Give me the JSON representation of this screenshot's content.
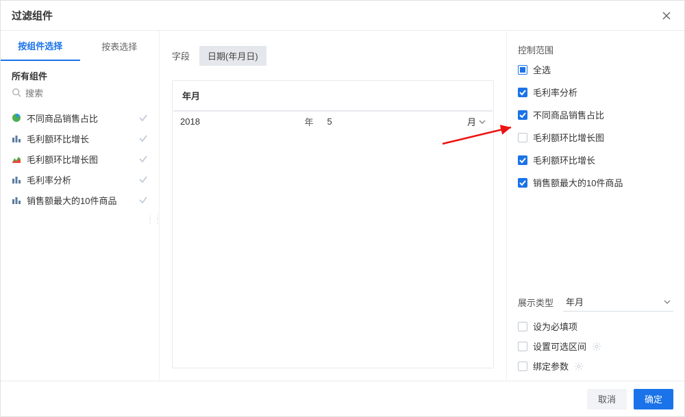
{
  "dialog": {
    "title": "过滤组件",
    "close_icon": "close"
  },
  "tabs": {
    "by_component": "按组件选择",
    "by_table": "按表选择"
  },
  "left": {
    "section_title": "所有组件",
    "search_placeholder": "搜索",
    "items": [
      {
        "label": "不同商品销售占比",
        "icon": "pie"
      },
      {
        "label": "毛利额环比增长",
        "icon": "bar"
      },
      {
        "label": "毛利额环比增长图",
        "icon": "area"
      },
      {
        "label": "毛利率分析",
        "icon": "bar"
      },
      {
        "label": "销售额最大的10件商品",
        "icon": "bar"
      }
    ]
  },
  "center": {
    "field_label": "字段",
    "field_chip": "日期(年月日)",
    "card_title": "年月",
    "year_value": "2018",
    "year_unit": "年",
    "month_value": "5",
    "month_unit": "月"
  },
  "right": {
    "scope_title": "控制范围",
    "select_all": "全选",
    "items": [
      {
        "label": "毛利率分析",
        "checked": true
      },
      {
        "label": "不同商品销售占比",
        "checked": true
      },
      {
        "label": "毛利额环比增长图",
        "checked": false
      },
      {
        "label": "毛利额环比增长",
        "checked": true
      },
      {
        "label": "销售额最大的10件商品",
        "checked": true
      }
    ],
    "display_type_label": "展示类型",
    "display_type_value": "年月",
    "options": {
      "required": "设为必填项",
      "range": "设置可选区间",
      "bind": "绑定参数"
    }
  },
  "footer": {
    "cancel": "取消",
    "confirm": "确定"
  }
}
